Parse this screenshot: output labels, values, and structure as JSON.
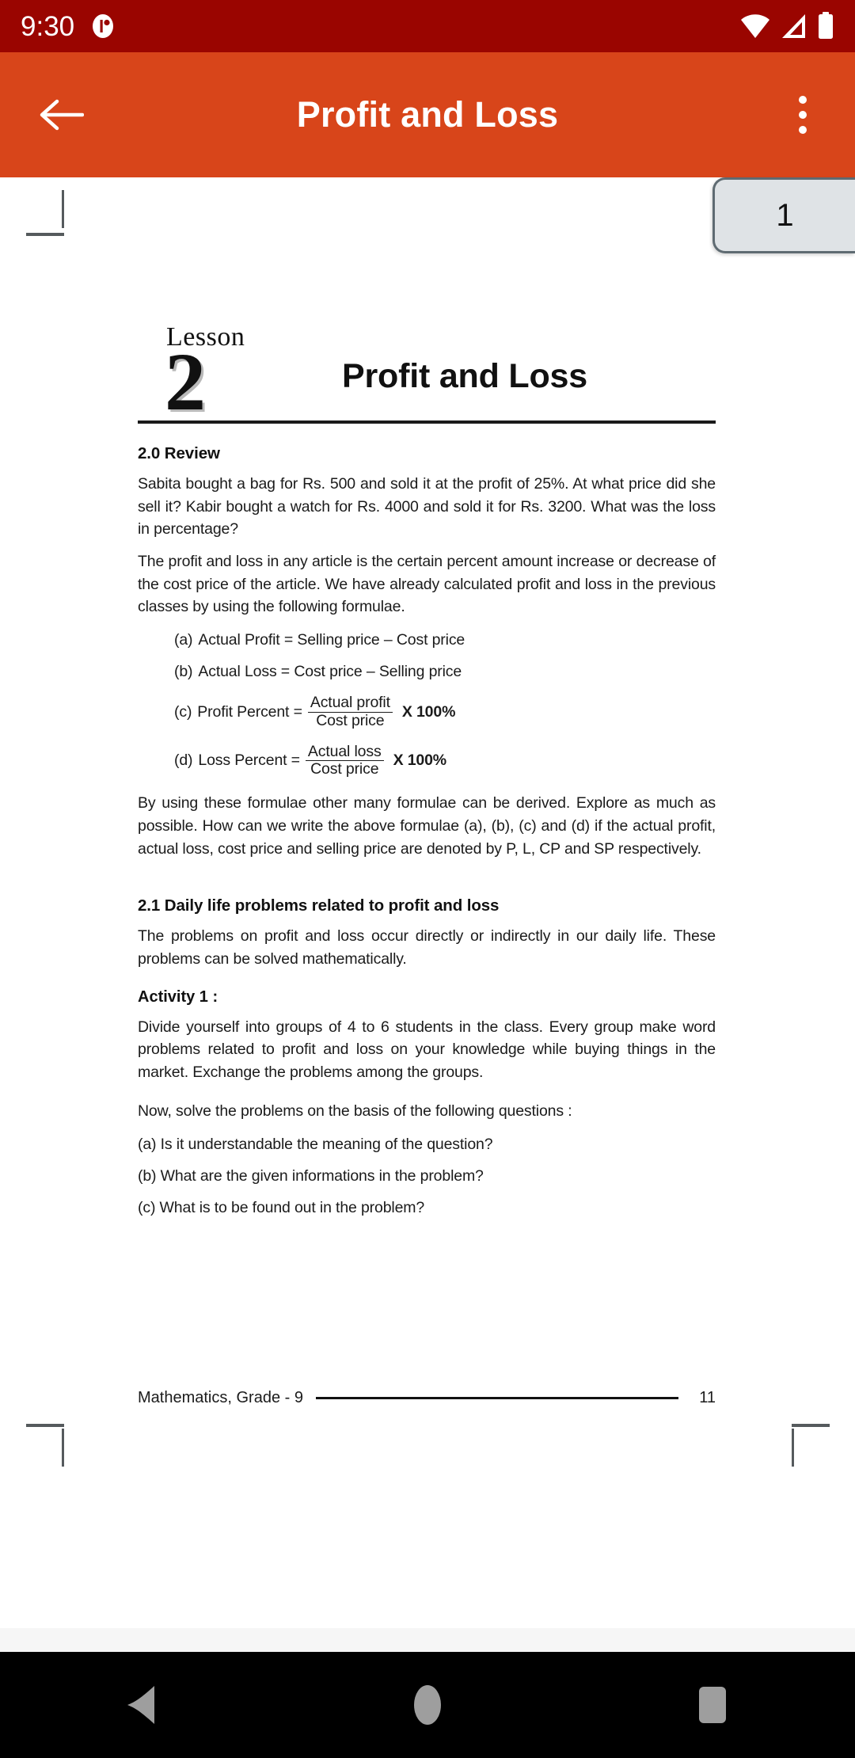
{
  "status_bar": {
    "clock": "9:30",
    "notification_icon": "app-notification-icon",
    "wifi_icon": "wifi-icon",
    "signal_icon": "cellular-signal-icon",
    "battery_icon": "battery-full-icon",
    "background_color": "#9a0500"
  },
  "app_bar": {
    "back_icon": "back-arrow-icon",
    "title": "Profit and Loss",
    "overflow_icon": "more-vertical-icon",
    "background_color": "#d8451a"
  },
  "page_badge": {
    "value": "1"
  },
  "document": {
    "lesson_label": "Lesson",
    "lesson_number": "2",
    "lesson_title": "Profit and Loss",
    "section_review": {
      "heading": "2.0  Review",
      "paragraph_1": "Sabita bought a bag for Rs. 500 and sold it at the profit of 25%. At what price did she sell it? Kabir bought a watch for Rs. 4000 and sold it for Rs. 3200. What was the loss in percentage?",
      "paragraph_2": "The profit and loss in any article is the certain percent amount increase or decrease of the cost price of the article. We have already calculated profit and loss in the previous classes by using the following formulae.",
      "formulae": [
        {
          "label": "(a)",
          "text": "Actual Profit = Selling price – Cost price"
        },
        {
          "label": "(b)",
          "text": "Actual Loss = Cost price – Selling price"
        },
        {
          "label": "(c)",
          "lhs": "Profit Percent =",
          "numerator": "Actual profit",
          "denominator": "Cost price",
          "rhs": "X 100%"
        },
        {
          "label": "(d)",
          "lhs": "Loss Percent =",
          "numerator": "Actual loss",
          "denominator": "Cost price",
          "rhs": "X 100%"
        }
      ],
      "paragraph_3": "By using these formulae other many formulae can be derived. Explore as much as possible. How can we write the above formulae (a), (b), (c) and (d) if the actual profit, actual loss, cost price and selling price are denoted by P, L, CP and SP respectively."
    },
    "section_daily_life": {
      "heading": "2.1  Daily life problems related to profit and loss",
      "paragraph_1": "The problems on profit and loss occur directly or indirectly in our daily life. These problems can be solved mathematically.",
      "activity_heading": "Activity 1 :",
      "activity_text": "Divide yourself into groups of 4 to 6 students in the class. Every group make word problems related to profit and loss on your knowledge while  buying things in the market. Exchange the problems among the groups.",
      "prompt": "Now, solve the problems on the basis of the following questions :",
      "questions": [
        "(a) Is it understandable the meaning of the question?",
        "(b) What are the given informations in the problem?",
        "(c) What is to be found out in the problem?"
      ]
    },
    "footer": {
      "left": "Mathematics, Grade - 9",
      "page_number": "11"
    }
  },
  "nav_bar": {
    "back_icon": "nav-back-triangle-icon",
    "home_icon": "nav-home-circle-icon",
    "recents_icon": "nav-recents-square-icon"
  }
}
